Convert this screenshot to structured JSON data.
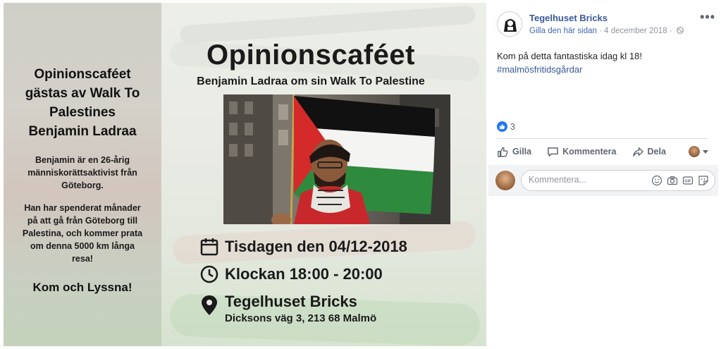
{
  "poster": {
    "left_panel": {
      "title": "Opinionscaféet gästas av Walk To Palestines Benjamin Ladraa",
      "body1": "Benjamin är en 26-årig människorättsaktivist från Göteborg.",
      "body2": "Han har spenderat månader på att gå från Göteborg till Palestina, och kommer prata om denna 5000 km långa resa!",
      "cta": "Kom och Lyssna!"
    },
    "title": "Opinionscaféet",
    "subtitle": "Benjamin Ladraa om sin Walk To Palestine",
    "date": "Tisdagen den 04/12-2018",
    "time": "Klockan 18:00 - 20:00",
    "place": "Tegelhuset Bricks",
    "address": "Dicksons väg 3, 213 68 Malmö",
    "icons": {
      "date": "calendar-icon",
      "time": "clock-icon",
      "place": "location-pin-icon"
    }
  },
  "post": {
    "page_name": "Tegelhuset Bricks",
    "like_page": "Gilla den här sidan",
    "separator": " · ",
    "date": "4 december 2018",
    "separator2": " · ",
    "text": "Kom på detta fantastiska idag kl 18!",
    "hashtag": "#malmösfritidsgårdar",
    "reaction_count": "3",
    "actions": {
      "like": "Gilla",
      "comment": "Kommentera",
      "share": "Dela"
    },
    "comment_placeholder": "Kommentera...",
    "colors": {
      "link": "#385898",
      "like_blue": "#2078f4",
      "muted": "#90949c"
    }
  }
}
